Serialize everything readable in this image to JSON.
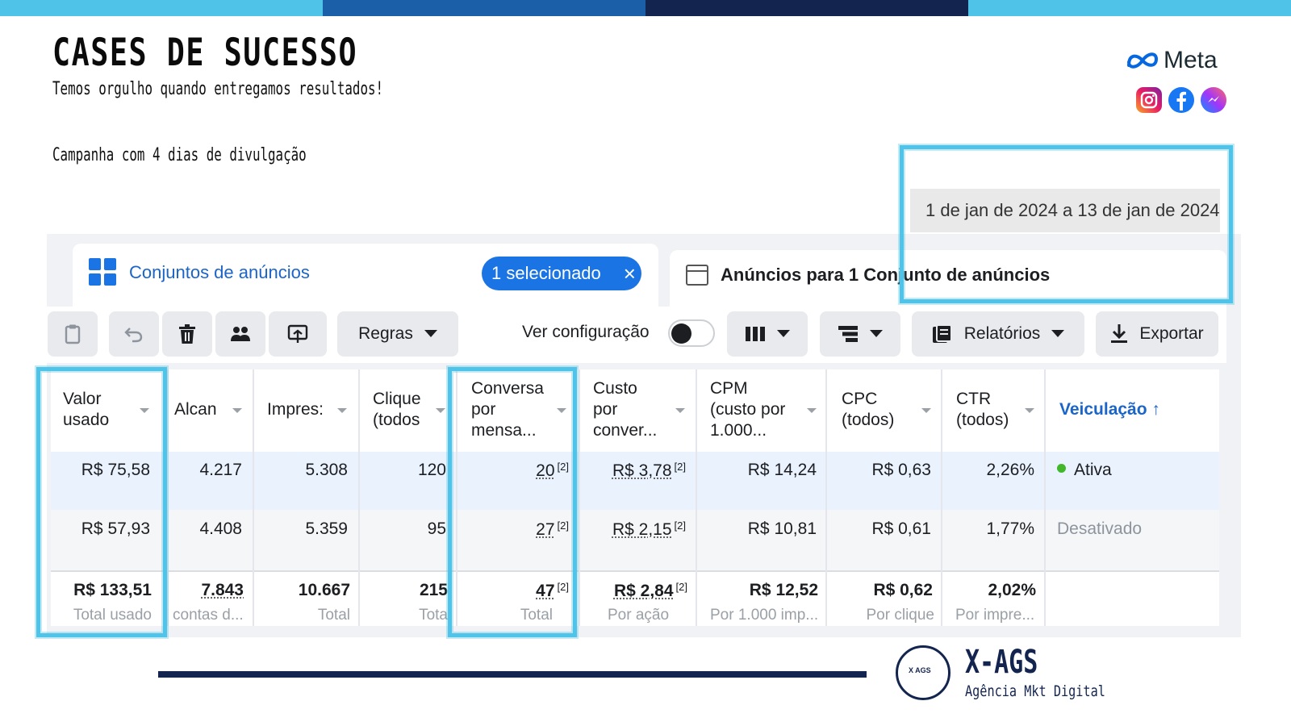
{
  "colors": {
    "top_bar": [
      "#4fc3e8",
      "#1a5fa8",
      "#13244f",
      "#4fc3e8"
    ],
    "accent_frame": "#4fc3e8",
    "facebook_blue": "#1b74e4",
    "brand_navy": "#13244f",
    "status_active": "#42b72a"
  },
  "header": {
    "title": "CASES DE SUCESSO",
    "subtitle": "Temos orgulho quando entregamos resultados!",
    "campaign_note": "Campanha com 4 dias de divulgação"
  },
  "brand": {
    "meta_label": "Meta",
    "social_icons": [
      "instagram-icon",
      "facebook-icon",
      "messenger-icon"
    ]
  },
  "date_range": "1 de jan de 2024 a 13 de jan de 2024",
  "tabs": {
    "adsets_label": "Conjuntos de anúncios",
    "selected_label": "1 selecionado",
    "selected_close": "×",
    "ads_label": "Anúncios para 1 Conjunto de anúncios"
  },
  "toolbar": {
    "rules_label": "Regras",
    "view_setting_label": "Ver configuração",
    "reports_label": "Relatórios",
    "export_label": "Exportar"
  },
  "table": {
    "headers": {
      "spent": "Valor\nusado",
      "reach": "Alcan",
      "impressions": "Impres:",
      "clicks": "Clique\n(todos",
      "conversations": "Conversa\npor\nmensa...",
      "cost_conv": "Custo\npor\nconver...",
      "cpm": "CPM\n(custo por\n1.000...",
      "cpc": "CPC\n(todos)",
      "ctr": "CTR\n(todos)",
      "delivery": "Veiculação ↑"
    },
    "rows": [
      {
        "spent": "R$ 75,58",
        "reach": "4.217",
        "impressions": "5.308",
        "clicks": "120",
        "conversations": "20",
        "conv_note": "[2]",
        "cost_conv": "R$ 3,78",
        "cost_note": "[2]",
        "cpm": "R$ 14,24",
        "cpc": "R$ 0,63",
        "ctr": "2,26%",
        "delivery": "Ativa"
      },
      {
        "spent": "R$ 57,93",
        "reach": "4.408",
        "impressions": "5.359",
        "clicks": "95",
        "conversations": "27",
        "conv_note": "[2]",
        "cost_conv": "R$ 2,15",
        "cost_note": "[2]",
        "cpm": "R$ 10,81",
        "cpc": "R$ 0,61",
        "ctr": "1,77%",
        "delivery": "Desativado"
      }
    ],
    "totals": {
      "spent": "R$ 133,51",
      "reach": "7.843",
      "impressions": "10.667",
      "clicks": "215",
      "conversations": "47",
      "conv_note": "[2]",
      "cost_conv": "R$ 2,84",
      "cost_note": "[2]",
      "cpm": "R$ 12,52",
      "cpc": "R$ 0,62",
      "ctr": "2,02%"
    },
    "total_labels": {
      "spent": "Total usado",
      "reach": "contas d...",
      "impressions": "Total",
      "clicks": "Tota",
      "conversations": "Total",
      "cost_conv": "Por ação",
      "cpm": "Por 1.000 imp...",
      "cpc": "Por clique",
      "ctr": "Por impre..."
    }
  },
  "footer": {
    "logo_mark": "X AGS",
    "agency_name": "X-AGS",
    "agency_tagline": "Agência Mkt Digital"
  }
}
